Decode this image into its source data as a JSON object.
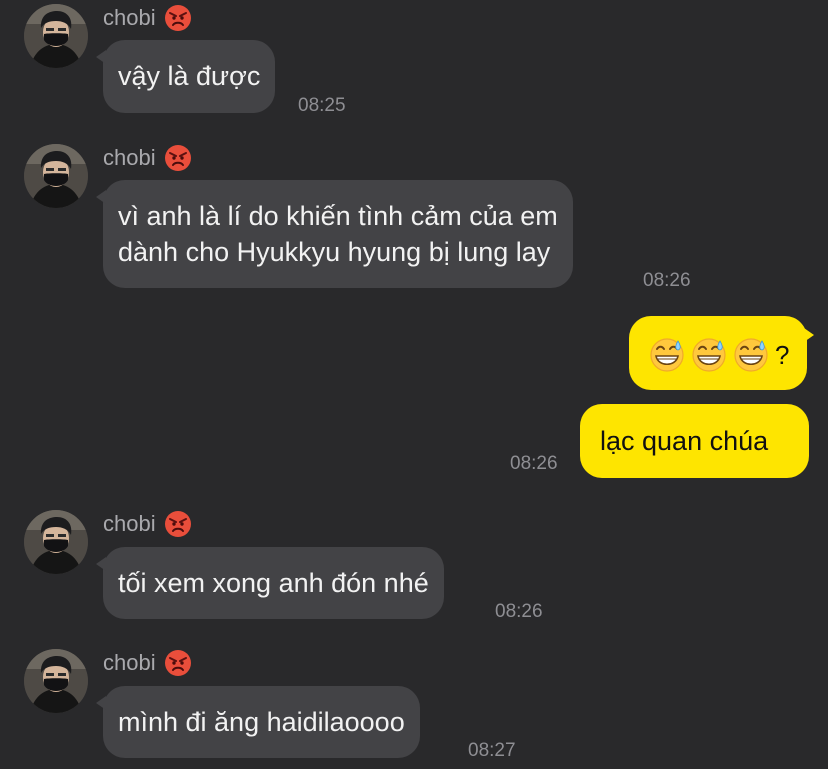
{
  "chat": {
    "messages": [
      {
        "sender": "chobi",
        "text": "vậy là được",
        "time": "08:25"
      },
      {
        "sender": "chobi",
        "lines": [
          "vì anh là lí do khiến tình cảm của em",
          "dành cho Hyukkyu hyung bị lung lay"
        ],
        "time": "08:26"
      },
      {
        "sender": "me",
        "emoji": [
          "grinning-sweat",
          "grinning-sweat",
          "grinning-sweat"
        ],
        "text": "?"
      },
      {
        "sender": "me",
        "text": "lạc quan chúa",
        "time": "08:26"
      },
      {
        "sender": "chobi",
        "text": "tối xem xong anh đón nhé",
        "time": "08:26"
      },
      {
        "sender": "chobi",
        "text": "mình đi ăng haidilaoooo",
        "time": "08:27"
      }
    ]
  },
  "colors": {
    "background": "#29292b",
    "incoming_bubble": "#434346",
    "outgoing_bubble": "#fee500",
    "name_text": "#a9a9ad",
    "time_text": "#8e8e93"
  },
  "icons": {
    "sender_badge": "angry-face-icon",
    "avatar": "avatar-photo",
    "emoji": "grinning-sweat-icon"
  }
}
